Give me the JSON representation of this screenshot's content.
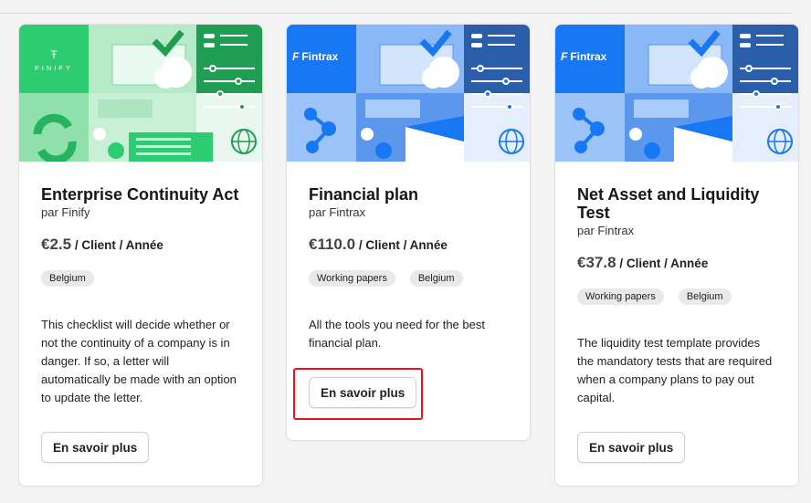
{
  "cards": [
    {
      "brand": "FINIFY",
      "title": "Enterprise Continuity Act",
      "by": "par Finify",
      "price_amount": "€2.5",
      "price_unit": "/ Client / Année",
      "tags": [
        "Belgium"
      ],
      "description": "This checklist will decide whether or not the continuity of a company is in danger. If so, a letter will automatically be made with an option to update the letter.",
      "button": "En savoir plus",
      "accent": "#2ecc71"
    },
    {
      "brand": "Fintrax",
      "title": "Financial plan",
      "by": "par Fintrax",
      "price_amount": "€110.0",
      "price_unit": "/ Client / Année",
      "tags": [
        "Working papers",
        "Belgium"
      ],
      "description": "All the tools you need for the best financial plan.",
      "button": "En savoir plus",
      "accent": "#1877f2"
    },
    {
      "brand": "Fintrax",
      "title": "Net Asset and Liquidity Test",
      "by": "par Fintrax",
      "price_amount": "€37.8",
      "price_unit": "/ Client / Année",
      "tags": [
        "Working papers",
        "Belgium"
      ],
      "description": "The liquidity test template provides the mandatory tests that are required when a company plans to pay out capital.",
      "button": "En savoir plus",
      "accent": "#1877f2"
    }
  ],
  "highlight_color": "#e8131b"
}
